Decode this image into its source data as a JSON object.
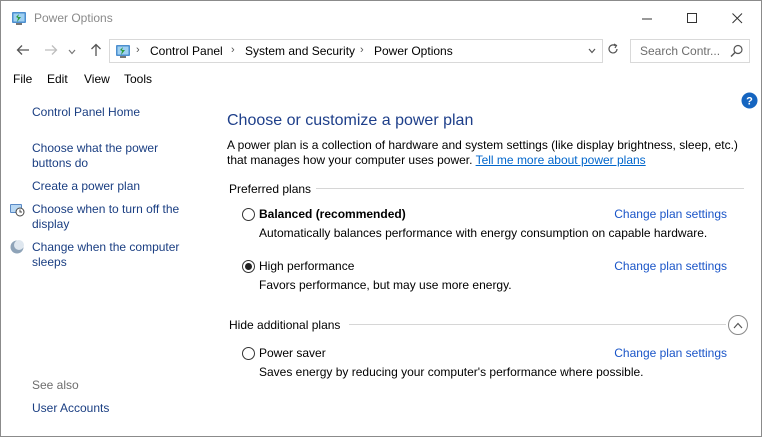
{
  "window": {
    "title": "Power Options",
    "minimize_icon": "minimize-icon",
    "maximize_icon": "maximize-icon",
    "close_icon": "close-icon"
  },
  "address": {
    "breadcrumbs": [
      "Control Panel",
      "System and Security",
      "Power Options"
    ],
    "search_placeholder": "Search Contr..."
  },
  "menu": {
    "items": [
      "File",
      "Edit",
      "View",
      "Tools"
    ]
  },
  "sidebar": {
    "home_link": "Control Panel Home",
    "links": [
      "Choose what the power buttons do",
      "Create a power plan",
      "Choose when to turn off the display",
      "Change when the computer sleeps"
    ],
    "see_also_caption": "See also",
    "see_also_links": [
      "User Accounts"
    ]
  },
  "main": {
    "title": "Choose or customize a power plan",
    "intro_text": "A power plan is a collection of hardware and system settings (like display brightness, sleep, etc.) that manages how your computer uses power.",
    "intro_link": "Tell me more about power plans",
    "preferred_header": "Preferred plans",
    "additional_header": "Hide additional plans",
    "plans": [
      {
        "name": "Balanced (recommended)",
        "description": "Automatically balances performance with energy consumption on capable hardware.",
        "link": "Change plan settings",
        "selected": false
      },
      {
        "name": "High performance",
        "description": "Favors performance, but may use more energy.",
        "link": "Change plan settings",
        "selected": true
      },
      {
        "name": "Power saver",
        "description": "Saves energy by reducing your computer's performance where possible.",
        "link": "Change plan settings",
        "selected": false
      }
    ]
  },
  "colors": {
    "link": "#1a55c8",
    "heading": "#1e3f8a",
    "help_badge": "#1565c0"
  }
}
